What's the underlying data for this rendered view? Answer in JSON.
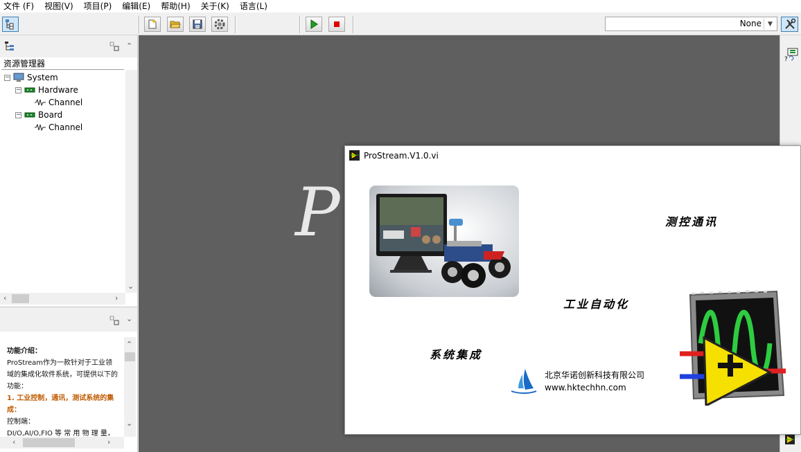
{
  "menu": [
    "文件 (F)",
    "视图(V)",
    "项目(P)",
    "编辑(E)",
    "帮助(H)",
    "关于(K)",
    "语言(L)"
  ],
  "toolbar": {
    "dropdown_value": "None"
  },
  "panel": {
    "tree_header": "资源管理器",
    "tree": [
      {
        "label": "System",
        "level": 0
      },
      {
        "label": "Hardware",
        "level": 1
      },
      {
        "label": "Channel",
        "level": 2
      },
      {
        "label": "Board",
        "level": 1
      },
      {
        "label": "Channel",
        "level": 2
      }
    ],
    "description": {
      "heading": "功能介绍：",
      "body": "ProStream作为一款针对于工业领域的集成化软件系统，可提供以下的功能：",
      "feature1": "1. 工业控制，通讯，测试系统的集成：",
      "control_label": "控制端：",
      "control_detail": "DI/O,AI/O,FIO 等 常 用 物 理 量，"
    }
  },
  "workspace": {
    "big_text": "Pr"
  },
  "splash": {
    "title": "ProStream.V1.0.vi",
    "text1": "测控通讯",
    "text2": "工业自动化",
    "text3": "系统集成",
    "company_name": "北京华诺创新科技有限公司",
    "company_url": "www.hktechhn.com"
  },
  "colors": {
    "workspace_bg": "#5f5f5f",
    "run_green": "#1fa01f",
    "stop_red": "#e00000",
    "orange_text": "#c05a00"
  }
}
